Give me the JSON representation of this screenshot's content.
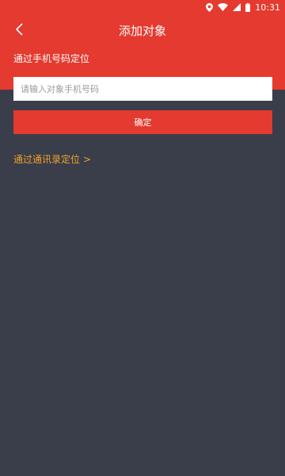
{
  "status_bar": {
    "time": "10:31",
    "icons": [
      "location-icon",
      "wifi-icon",
      "signal-icon",
      "battery-icon"
    ]
  },
  "header": {
    "title": "添加对象",
    "back_icon": "chevron-left-icon",
    "section_label": "通过手机号码定位"
  },
  "form": {
    "phone_placeholder": "请输入对象手机号码",
    "phone_value": "",
    "confirm_label": "确定"
  },
  "links": {
    "contacts_label": "通过通讯录定位 >"
  },
  "colors": {
    "primary_red": "#e53a2f",
    "background": "#3a3d4a",
    "link_orange": "#f0a22a"
  }
}
